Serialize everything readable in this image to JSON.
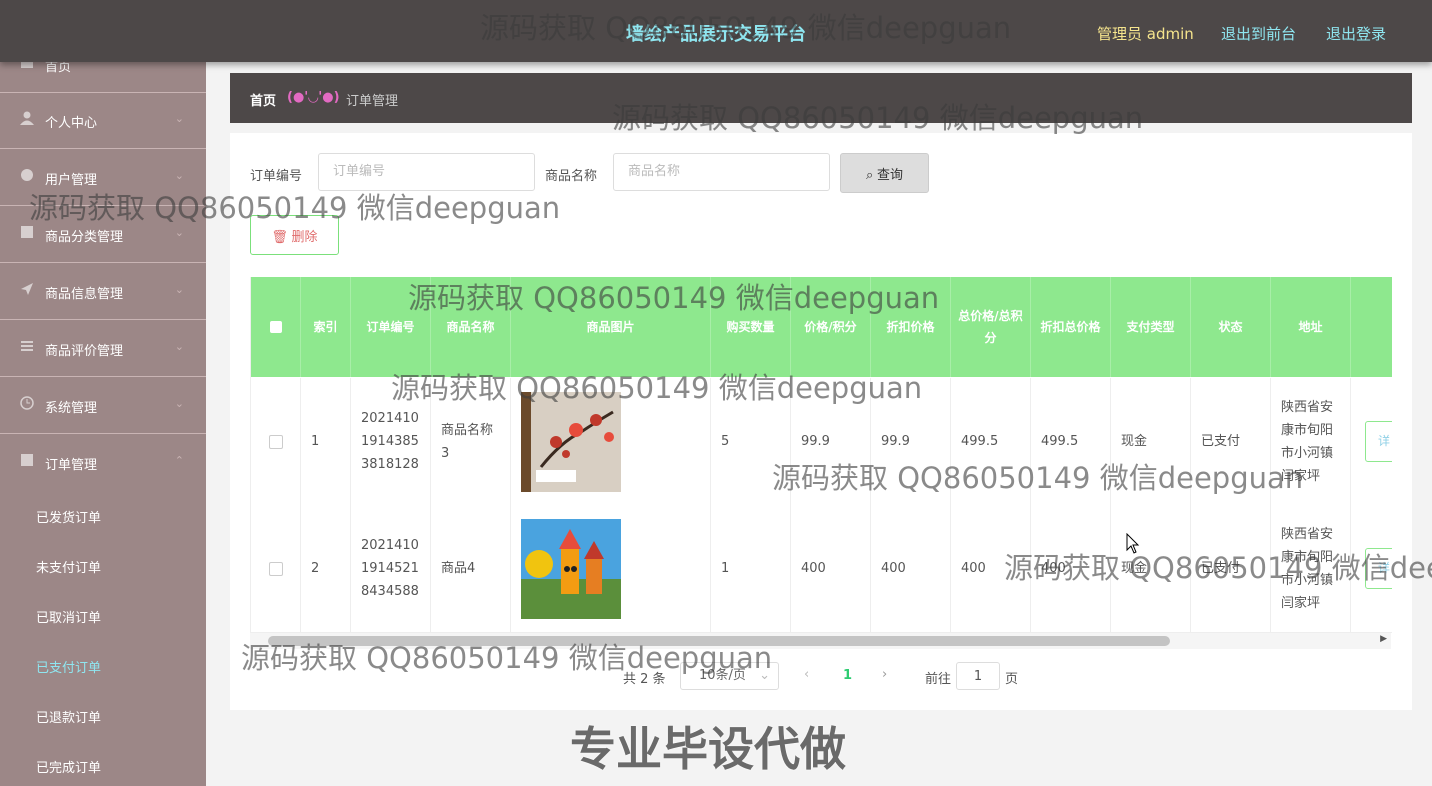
{
  "header": {
    "title": "墙绘产品展示交易平台",
    "admin_label": "管理员 admin",
    "front_link": "退出到前台",
    "logout_link": "退出登录"
  },
  "sidebar": {
    "items": [
      {
        "label": "首页"
      },
      {
        "label": "个人中心"
      },
      {
        "label": "用户管理"
      },
      {
        "label": "商品分类管理"
      },
      {
        "label": "商品信息管理"
      },
      {
        "label": "商品评价管理"
      },
      {
        "label": "系统管理"
      },
      {
        "label": "订单管理"
      }
    ],
    "sub_items": [
      {
        "label": "已发货订单"
      },
      {
        "label": "未支付订单"
      },
      {
        "label": "已取消订单"
      },
      {
        "label": "已支付订单"
      },
      {
        "label": "已退款订单"
      },
      {
        "label": "已完成订单"
      }
    ]
  },
  "breadcrumb": {
    "home": "首页",
    "emoticon": "(●'◡'●)",
    "current": "订单管理"
  },
  "search": {
    "order_no_label": "订单编号",
    "order_no_placeholder": "订单编号",
    "product_label": "商品名称",
    "product_placeholder": "商品名称",
    "query_button": "查询",
    "delete_button": "删除"
  },
  "table": {
    "headers": {
      "index": "索引",
      "order_no": "订单编号",
      "product_name": "商品名称",
      "product_image": "商品图片",
      "quantity": "购买数量",
      "price": "价格/积分",
      "discount_price": "折扣价格",
      "total": "总价格/总积分",
      "discount_total": "折扣总价格",
      "pay_type": "支付类型",
      "status": "状态",
      "address": "地址"
    },
    "rows": [
      {
        "index": "1",
        "order_no": "20214101914385381812 8",
        "order_no_l1": "2021410",
        "order_no_l2": "1914385",
        "order_no_l3": "3818128",
        "product_name_l1": "商品名称",
        "product_name_l2": "3",
        "quantity": "5",
        "price": "99.9",
        "discount_price": "99.9",
        "total": "499.5",
        "discount_total": "499.5",
        "pay_type": "现金",
        "status": "已支付",
        "addr_l1": "陕西省安",
        "addr_l2": "康市旬阳",
        "addr_l3": "市小河镇",
        "addr_l4": "闫家坪",
        "action": "详"
      },
      {
        "index": "2",
        "order_no_l1": "2021410",
        "order_no_l2": "1914521",
        "order_no_l3": "8434588",
        "product_name_l1": "商品4",
        "product_name_l2": "",
        "quantity": "1",
        "price": "400",
        "discount_price": "400",
        "total": "400",
        "discount_total": "400",
        "pay_type": "现金",
        "status": "已支付",
        "addr_l1": "陕西省安",
        "addr_l2": "康市旬阳",
        "addr_l3": "市小河镇",
        "addr_l4": "闫家坪",
        "action": "详"
      }
    ]
  },
  "pager": {
    "total": "共 2 条",
    "page_size": "10条/页",
    "current_page": "1",
    "goto_label": "前往",
    "goto_value": "1",
    "page_suffix": "页"
  },
  "watermark": {
    "text": "源码获取 QQ86050149 微信deepguan",
    "big": "专业毕设代做"
  }
}
